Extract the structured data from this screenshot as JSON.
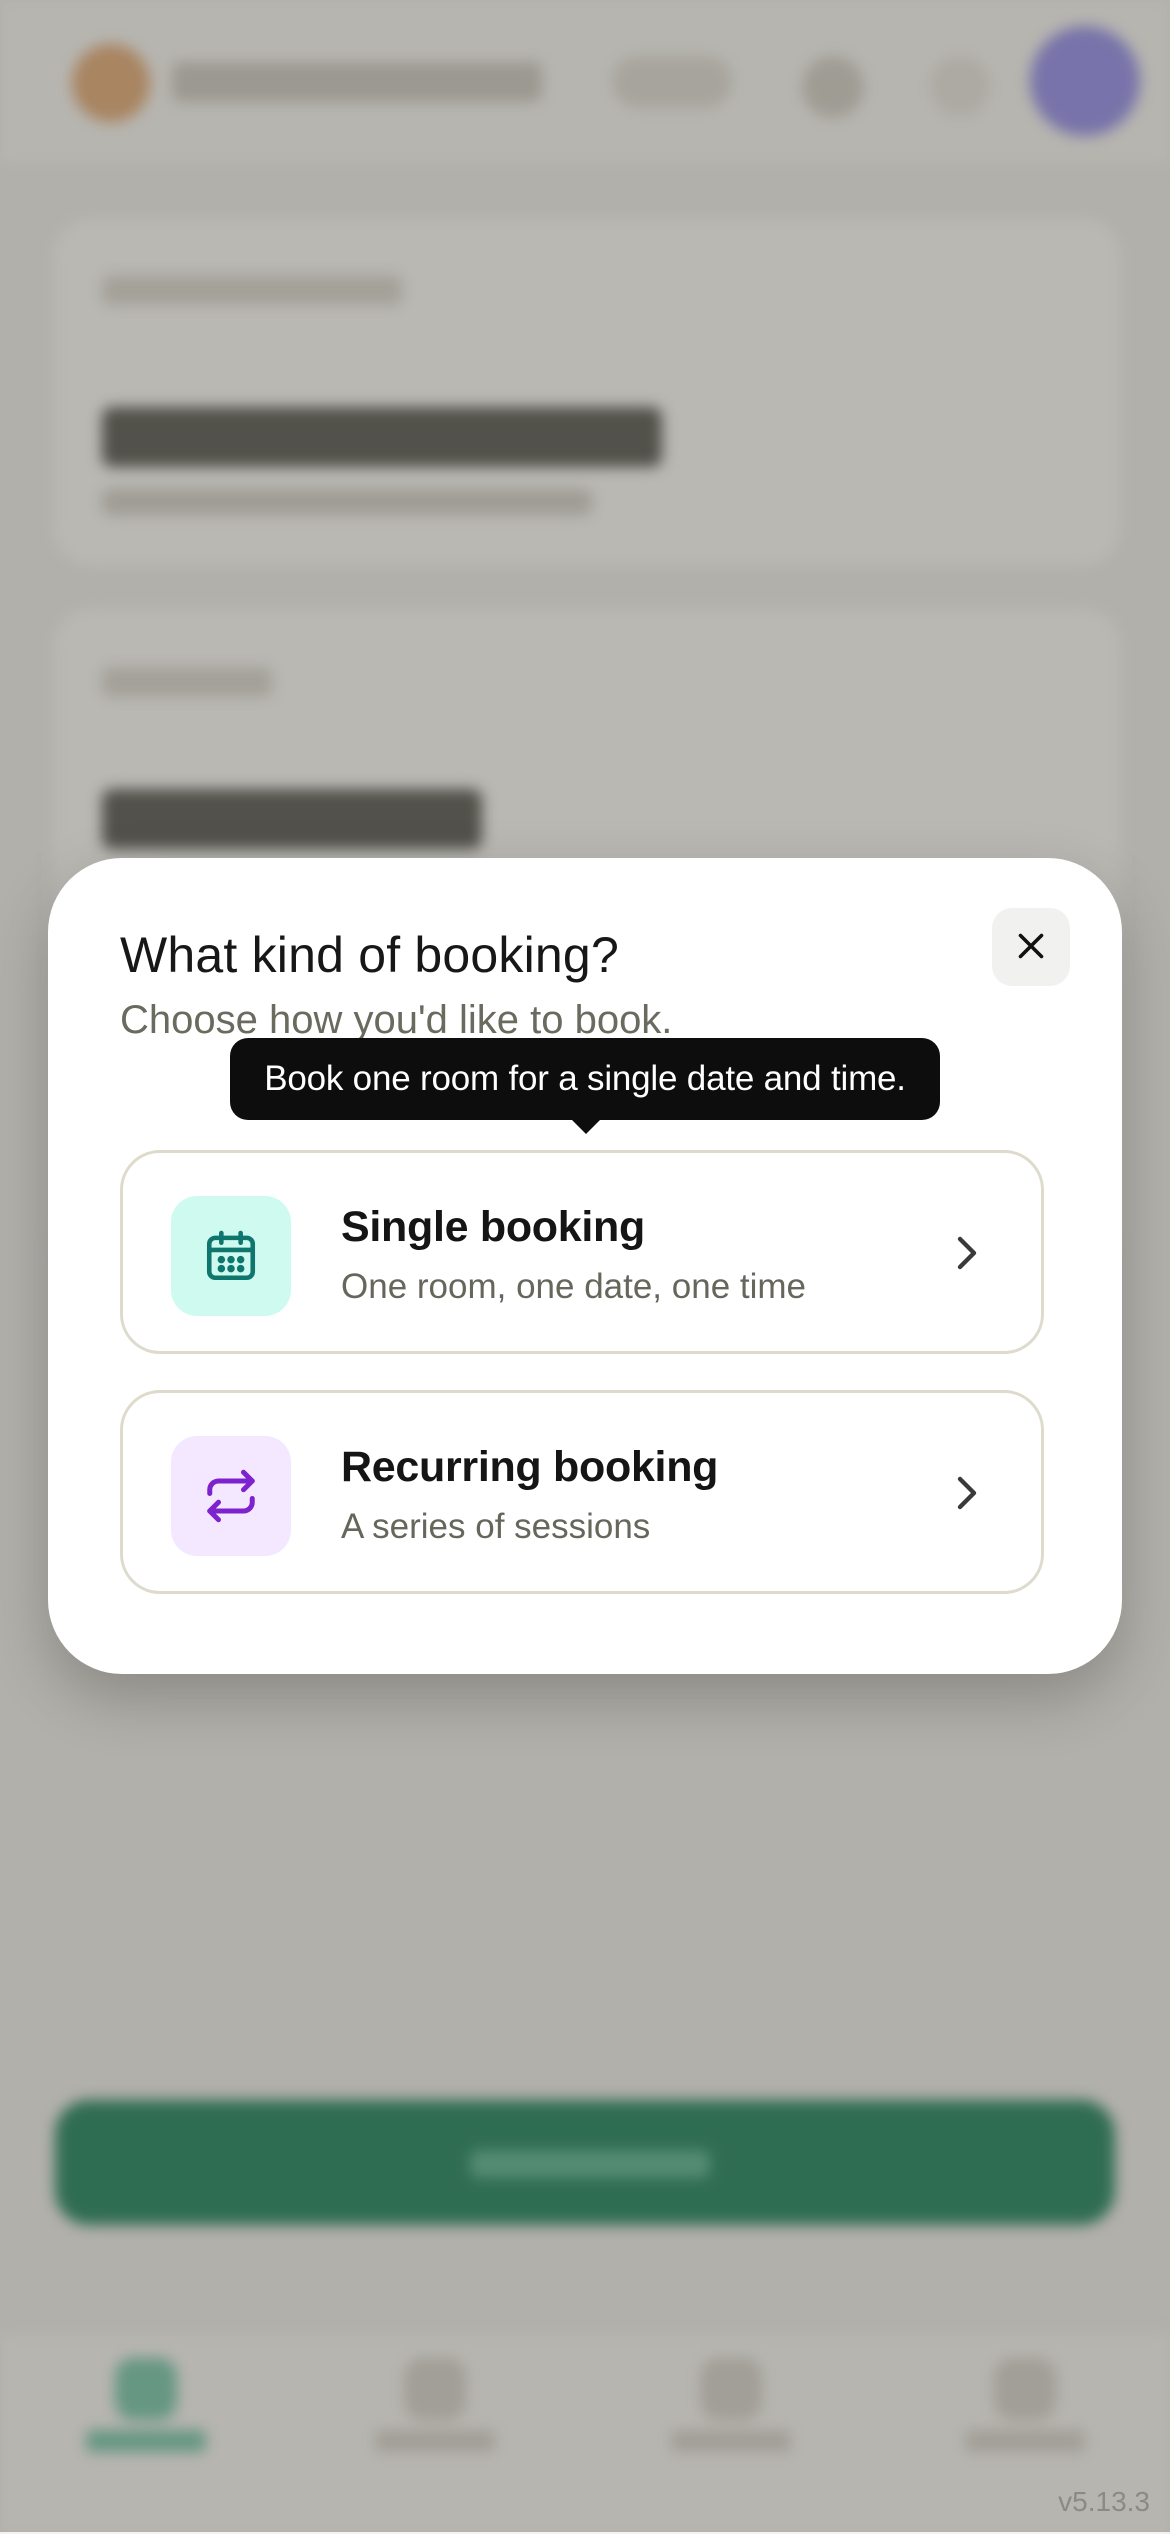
{
  "modal": {
    "title": "What kind of booking?",
    "subtitle": "Choose how you'd like to book.",
    "close_icon": "close-icon",
    "tooltip": "Book one room for a single date and time.",
    "options": [
      {
        "title": "Single booking",
        "description": "One room, one date, one time",
        "icon": "calendar-icon",
        "icon_color": "#0f766e",
        "icon_bg": "#cffaef"
      },
      {
        "title": "Recurring booking",
        "description": "A series of sessions",
        "icon": "repeat-icon",
        "icon_color": "#7e22ce",
        "icon_bg": "#f3e8ff"
      }
    ]
  },
  "app": {
    "version": "v5.13.3",
    "accent_color": "#0f7a52"
  }
}
